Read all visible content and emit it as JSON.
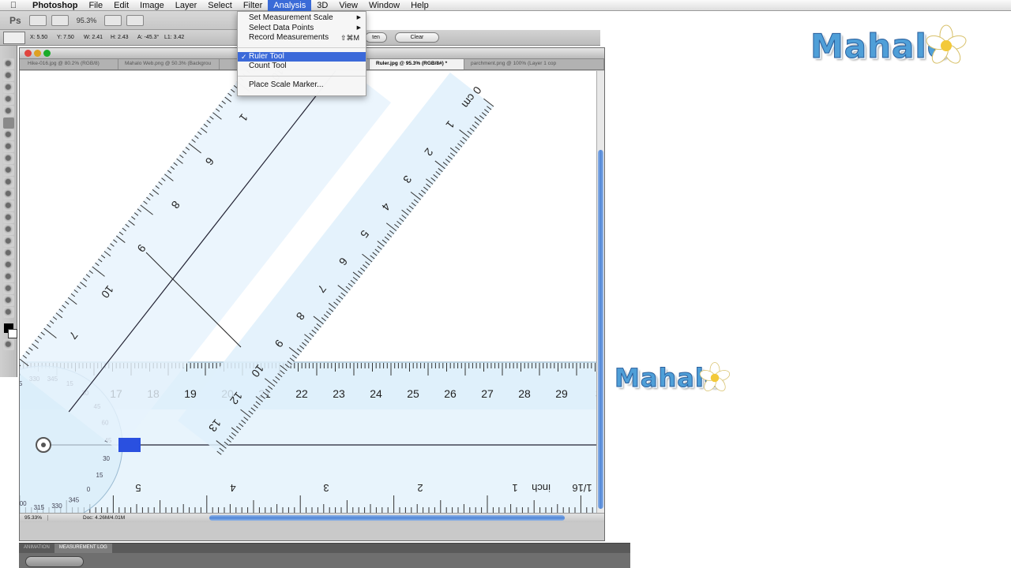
{
  "menubar": {
    "app_name": "Photoshop",
    "items": [
      "File",
      "Edit",
      "Image",
      "Layer",
      "Select",
      "Filter",
      "Analysis",
      "3D",
      "View",
      "Window",
      "Help"
    ],
    "active": "Analysis"
  },
  "appbar": {
    "badge": "Ps",
    "zoom": "95.3%"
  },
  "options": {
    "readouts": [
      "X: 5.50",
      "Y: 7.50",
      "W: 2.41",
      "H: 2.43",
      "A: -45.3°",
      "L1: 3.42"
    ],
    "straighten_label": "Straighten",
    "straighten_visible": "ten",
    "clear_label": "Clear"
  },
  "document": {
    "tabs": [
      "Hike-016.jpg @ 80.2% (RGB/8)",
      "Mahalo Web.png @ 50.3% (Backgrou",
      "",
      "Ruler.jpg @ 95.3% (RGB/8#) *",
      "parchment.png @ 100% (Layer 1 cop"
    ],
    "active_tab": 3,
    "status_zoom": "95.33%",
    "status_doc": "Doc: 4.26M/4.01M"
  },
  "analysis_menu": {
    "items": [
      {
        "label": "Set Measurement Scale",
        "submenu": true
      },
      {
        "label": "Select Data Points",
        "submenu": true
      },
      {
        "label": "Record Measurements",
        "shortcut": "⇧⌘M"
      },
      {
        "label": "Ruler Tool",
        "checked": true,
        "highlighted": true
      },
      {
        "label": "Count Tool"
      },
      {
        "label": "Place Scale Marker..."
      }
    ]
  },
  "bottom_panel": {
    "tabs": [
      "Animation",
      "Measurement Log"
    ],
    "active": "Measurement Log"
  },
  "watermark": {
    "text": "Mahalo"
  },
  "ruler_image": {
    "cm_labels": [
      "17",
      "18",
      "19",
      "20",
      "21",
      "22",
      "23",
      "24",
      "25",
      "26",
      "27",
      "28",
      "29",
      "3"
    ],
    "inch_labels": [
      "5",
      "4",
      "3",
      "2",
      "1",
      "inch",
      "1/16"
    ],
    "diag_cm_labels": [
      "0 cm",
      "1",
      "2",
      "3",
      "4",
      "5",
      "6",
      "7",
      "8",
      "9",
      "10",
      "12",
      "13"
    ],
    "diag_inch_labels": [
      "10",
      "1",
      "6",
      "8",
      "9",
      "10",
      "7"
    ],
    "protractor_labels": [
      "300",
      "315",
      "330",
      "345",
      "15",
      "30",
      "45",
      "60",
      "45",
      "30",
      "15",
      "0",
      "345",
      "330",
      "315",
      "300"
    ]
  },
  "colors": {
    "menu_highlight": "#3b69d9",
    "ruler_tint": "#dff0fb",
    "scroll_thumb": "#4f86d8",
    "logo_blue": "#4f9fd8"
  }
}
